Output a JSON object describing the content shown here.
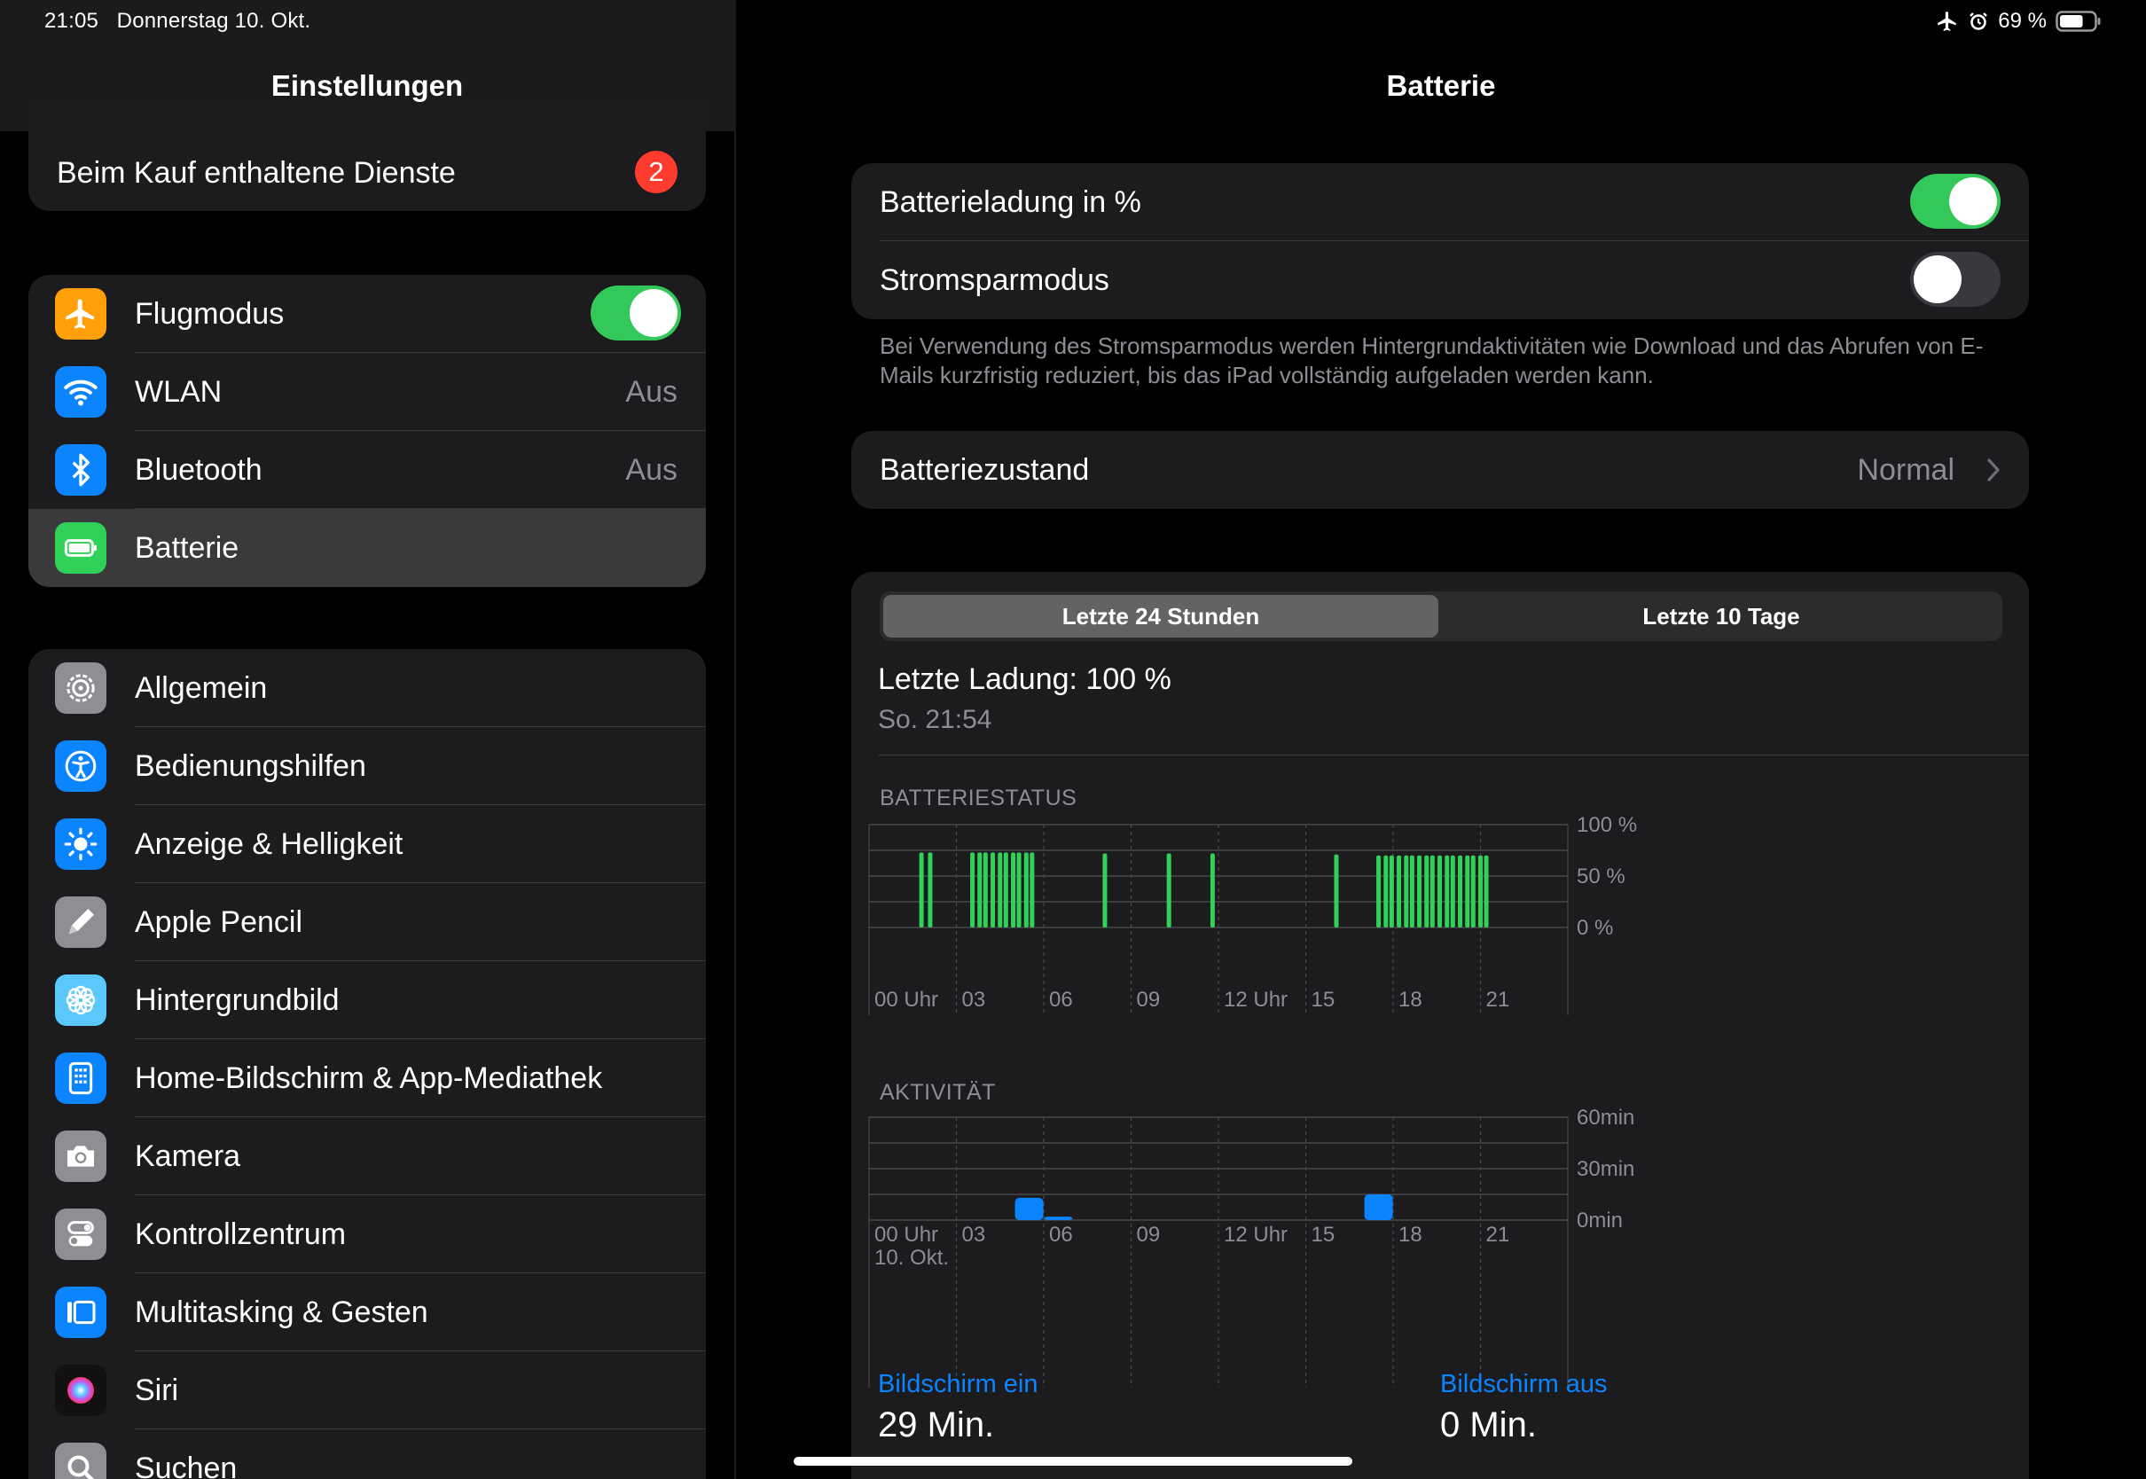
{
  "status_bar": {
    "time": "21:05",
    "date": "Donnerstag 10. Okt.",
    "battery_pct": "69 %",
    "battery_level": 0.69,
    "icons": [
      "airplane-icon",
      "alarm-icon",
      "battery-icon"
    ]
  },
  "sidebar": {
    "title": "Einstellungen",
    "services_row": {
      "label": "Beim Kauf enthaltene Dienste",
      "badge": "2"
    },
    "connectivity": [
      {
        "label": "Flugmodus",
        "icon": "airplane-icon",
        "toggle": true
      },
      {
        "label": "WLAN",
        "icon": "wifi-icon",
        "value": "Aus"
      },
      {
        "label": "Bluetooth",
        "icon": "bluetooth-icon",
        "value": "Aus"
      },
      {
        "label": "Batterie",
        "icon": "battery-icon",
        "selected": true
      }
    ],
    "general": [
      {
        "label": "Allgemein",
        "icon": "gear-icon"
      },
      {
        "label": "Bedienungshilfen",
        "icon": "accessibility-icon"
      },
      {
        "label": "Anzeige & Helligkeit",
        "icon": "sun-icon"
      },
      {
        "label": "Apple Pencil",
        "icon": "pencil-icon"
      },
      {
        "label": "Hintergrundbild",
        "icon": "flower-icon"
      },
      {
        "label": "Home-Bildschirm & App-Mediathek",
        "icon": "home-screen-icon"
      },
      {
        "label": "Kamera",
        "icon": "camera-icon"
      },
      {
        "label": "Kontrollzentrum",
        "icon": "switches-icon"
      },
      {
        "label": "Multitasking & Gesten",
        "icon": "multitasking-icon"
      },
      {
        "label": "Siri",
        "icon": "siri-icon"
      },
      {
        "label": "Suchen",
        "icon": "search-icon"
      }
    ]
  },
  "detail": {
    "title": "Batterie",
    "battery_percent_label": "Batterieladung in %",
    "battery_percent_on": true,
    "low_power_label": "Stromsparmodus",
    "low_power_on": false,
    "footnote": "Bei Verwendung des Stromsparmodus werden Hintergrundaktivitäten wie Download und das Abrufen von E-Mails kurzfristig reduziert, bis das iPad vollständig aufgeladen werden kann.",
    "health_label": "Batteriezustand",
    "health_value": "Normal",
    "segment": {
      "left": "Letzte 24 Stunden",
      "right": "Letzte 10 Tage",
      "active": "left"
    },
    "last_charge": "Letzte Ladung: 100 %",
    "last_charge_time": "So. 21:54",
    "battery_caption": "BATTERIESTATUS",
    "activity_caption": "AKTIVITÄT",
    "screen_on_label": "Bildschirm ein",
    "screen_on_value": "29 Min.",
    "screen_off_label": "Bildschirm aus",
    "screen_off_value": "0 Min."
  },
  "chart_data": [
    {
      "type": "bar",
      "title": "BATTERIESTATUS",
      "x_ticks": [
        "00 Uhr",
        "03",
        "06",
        "09",
        "12 Uhr",
        "15",
        "18",
        "21"
      ],
      "y_ticks": [
        "100 %",
        "50 %",
        "0 %"
      ],
      "ylim": [
        0,
        100
      ],
      "xlim_hours": [
        0,
        24
      ],
      "color": "#30d158",
      "points": [
        {
          "h": 1.8,
          "v": 73
        },
        {
          "h": 2.1,
          "v": 73
        },
        {
          "h": 3.55,
          "v": 73
        },
        {
          "h": 3.8,
          "v": 73
        },
        {
          "h": 4.0,
          "v": 73
        },
        {
          "h": 4.25,
          "v": 73
        },
        {
          "h": 4.5,
          "v": 73
        },
        {
          "h": 4.7,
          "v": 73
        },
        {
          "h": 4.95,
          "v": 73
        },
        {
          "h": 5.15,
          "v": 73
        },
        {
          "h": 5.4,
          "v": 73
        },
        {
          "h": 5.6,
          "v": 73
        },
        {
          "h": 8.1,
          "v": 72
        },
        {
          "h": 10.3,
          "v": 72
        },
        {
          "h": 11.8,
          "v": 72
        },
        {
          "h": 16.05,
          "v": 71
        },
        {
          "h": 17.5,
          "v": 70
        },
        {
          "h": 17.75,
          "v": 70
        },
        {
          "h": 17.95,
          "v": 70
        },
        {
          "h": 18.2,
          "v": 70
        },
        {
          "h": 18.45,
          "v": 70
        },
        {
          "h": 18.65,
          "v": 70
        },
        {
          "h": 18.9,
          "v": 70
        },
        {
          "h": 19.15,
          "v": 70
        },
        {
          "h": 19.35,
          "v": 70
        },
        {
          "h": 19.6,
          "v": 70
        },
        {
          "h": 19.85,
          "v": 70
        },
        {
          "h": 20.05,
          "v": 70
        },
        {
          "h": 20.3,
          "v": 70
        },
        {
          "h": 20.55,
          "v": 70
        },
        {
          "h": 20.75,
          "v": 70
        },
        {
          "h": 21.0,
          "v": 70
        },
        {
          "h": 21.2,
          "v": 70
        }
      ]
    },
    {
      "type": "bar",
      "title": "AKTIVITÄT",
      "x_ticks": [
        "00 Uhr",
        "03",
        "06",
        "09",
        "12 Uhr",
        "15",
        "18",
        "21"
      ],
      "x_sublabel": "10. Okt.",
      "y_ticks": [
        "60min",
        "30min",
        "0min"
      ],
      "ylim": [
        0,
        60
      ],
      "xlim_hours": [
        0,
        24
      ],
      "color": "#0a84ff",
      "points": [
        {
          "h": 5.5,
          "v": 13
        },
        {
          "h": 6.5,
          "v": 2
        },
        {
          "h": 17.5,
          "v": 15
        }
      ]
    }
  ]
}
